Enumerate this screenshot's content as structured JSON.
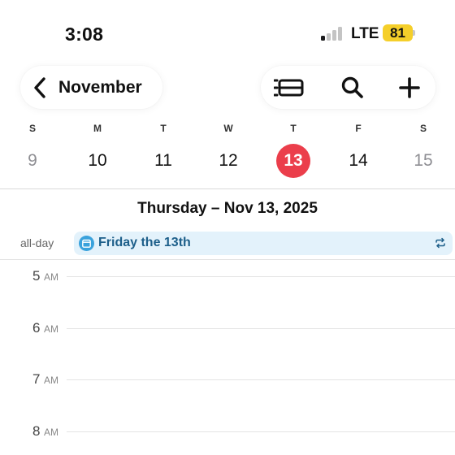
{
  "status_bar": {
    "time": "3:08",
    "network": "LTE",
    "battery": "81",
    "battery_color": "#f5cf2a",
    "signal_bars_active": 1,
    "signal_bars_total": 4
  },
  "header": {
    "back_label": "November",
    "back_icon": "chevron-left-icon",
    "tools": [
      {
        "name": "list-view-icon"
      },
      {
        "name": "search-icon"
      },
      {
        "name": "add-icon"
      }
    ]
  },
  "week": {
    "days": [
      {
        "dow": "S",
        "num": "9",
        "weekend": true
      },
      {
        "dow": "M",
        "num": "10",
        "weekend": false
      },
      {
        "dow": "T",
        "num": "11",
        "weekend": false
      },
      {
        "dow": "W",
        "num": "12",
        "weekend": false
      },
      {
        "dow": "T",
        "num": "13",
        "weekend": false,
        "selected": true
      },
      {
        "dow": "F",
        "num": "14",
        "weekend": false
      },
      {
        "dow": "S",
        "num": "15",
        "weekend": true
      }
    ],
    "selected_color": "#eb3e4b"
  },
  "day_title": "Thursday – Nov 13, 2025",
  "all_day": {
    "label": "all-day",
    "event": {
      "title": "Friday the 13th",
      "icon": "calendar-icon",
      "repeat_icon": "repeat-icon",
      "background": "#e3f2fb"
    }
  },
  "hours": [
    {
      "num": "5",
      "ampm": "AM"
    },
    {
      "num": "6",
      "ampm": "AM"
    },
    {
      "num": "7",
      "ampm": "AM"
    },
    {
      "num": "8",
      "ampm": "AM"
    }
  ]
}
